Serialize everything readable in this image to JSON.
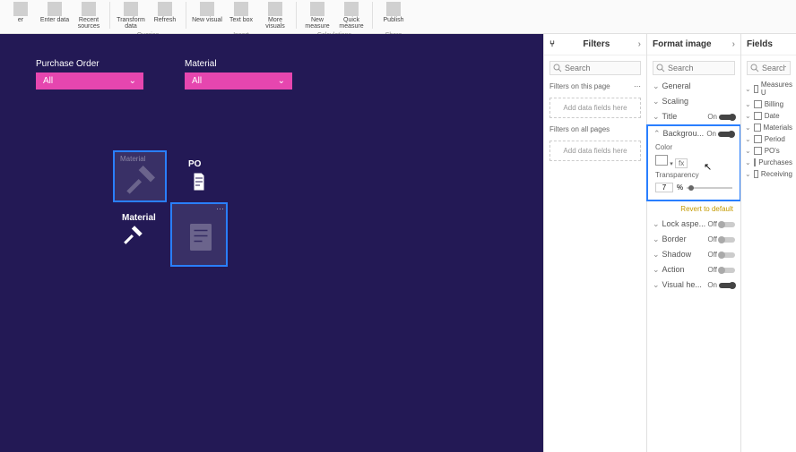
{
  "ribbon": {
    "buttons": [
      "er",
      "Enter data",
      "Recent sources",
      "Transform data",
      "Refresh",
      "New visual",
      "Text box",
      "More visuals",
      "New measure",
      "Quick measure",
      "Publish"
    ],
    "groups": [
      "Queries",
      "Insert",
      "Calculations",
      "Share"
    ]
  },
  "canvas": {
    "slicer1": {
      "label": "Purchase Order",
      "value": "All"
    },
    "slicer2": {
      "label": "Material",
      "value": "All"
    },
    "img_labels": {
      "material": "Material",
      "po": "PO"
    }
  },
  "filters": {
    "title": "Filters",
    "search_ph": "Search",
    "on_page": "Filters on this page",
    "on_all": "Filters on all pages",
    "add": "Add data fields here"
  },
  "format": {
    "title": "Format image",
    "search_ph": "Search",
    "sections": {
      "general": "General",
      "scaling": "Scaling",
      "title_lbl": "Title",
      "background": "Backgrou...",
      "color": "Color",
      "transparency": "Transparency",
      "trans_val": "7",
      "trans_unit": "%",
      "lock": "Lock aspe...",
      "border": "Border",
      "shadow": "Shadow",
      "action": "Action",
      "visualh": "Visual he..."
    },
    "on": "On",
    "off": "Off",
    "revert": "Revert to default"
  },
  "fields": {
    "title": "Fields",
    "search_ph": "Search",
    "tables": [
      "Measures U",
      "Billing",
      "Date",
      "Materials",
      "Period",
      "PO's",
      "Purchases",
      "Receiving"
    ]
  }
}
